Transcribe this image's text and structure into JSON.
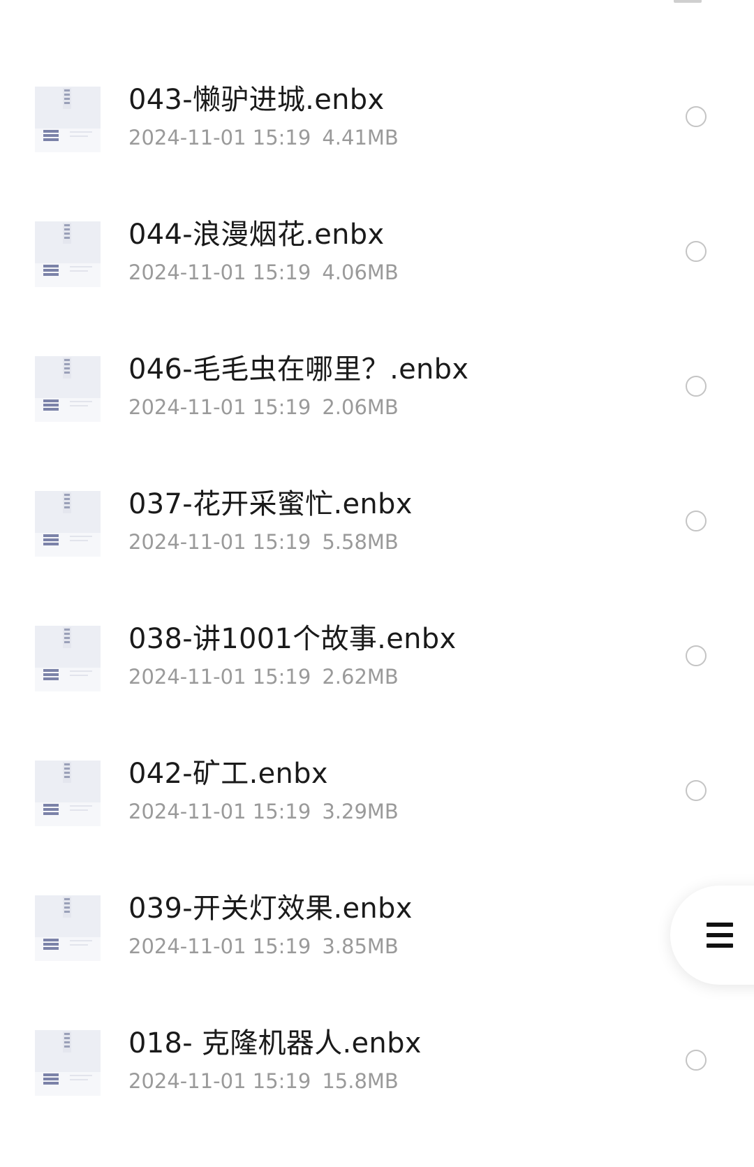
{
  "files": [
    {
      "name": "043-懒驴进城.enbx",
      "date": "2024-11-01 15:19",
      "size": "4.41MB"
    },
    {
      "name": "044-浪漫烟花.enbx",
      "date": "2024-11-01 15:19",
      "size": "4.06MB"
    },
    {
      "name": "046-毛毛虫在哪里？.enbx",
      "date": "2024-11-01 15:19",
      "size": "2.06MB"
    },
    {
      "name": "037-花开采蜜忙.enbx",
      "date": "2024-11-01 15:19",
      "size": "5.58MB"
    },
    {
      "name": "038-讲1001个故事.enbx",
      "date": "2024-11-01 15:19",
      "size": "2.62MB"
    },
    {
      "name": "042-矿工.enbx",
      "date": "2024-11-01 15:19",
      "size": "3.29MB"
    },
    {
      "name": "039-开关灯效果.enbx",
      "date": "2024-11-01 15:19",
      "size": "3.85MB"
    },
    {
      "name": "018- 克隆机器人.enbx",
      "date": "2024-11-01 15:19",
      "size": "15.8MB"
    }
  ],
  "icons": {
    "file": "zip-archive-icon",
    "select": "radio-unchecked-icon",
    "menu": "menu-icon"
  }
}
